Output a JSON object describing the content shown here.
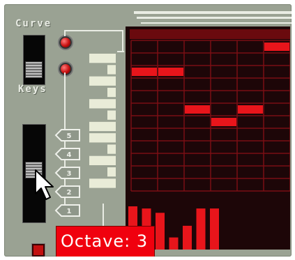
{
  "labels": {
    "curve": "Curve",
    "keys": "Keys"
  },
  "octave_buttons": [
    "5",
    "4",
    "3",
    "2",
    "1"
  ],
  "tooltip": {
    "text": "Octave: 3"
  },
  "octave": {
    "selected": 3
  },
  "pattern_grid": {
    "rows": 12,
    "cols": 6,
    "active_notes": [
      {
        "step": 1,
        "row": 3
      },
      {
        "step": 2,
        "row": 3
      },
      {
        "step": 3,
        "row": 6
      },
      {
        "step": 4,
        "row": 7
      },
      {
        "step": 5,
        "row": 6
      },
      {
        "step": 6,
        "row": 1
      }
    ],
    "velocity": [
      1.0,
      0.95,
      0.85,
      0.28,
      0.55,
      0.95,
      0.95
    ]
  },
  "colors": {
    "accent": "#f0000e",
    "note": "#e8151b",
    "grid_bg": "#1d0608",
    "panel": "#9aa293"
  }
}
